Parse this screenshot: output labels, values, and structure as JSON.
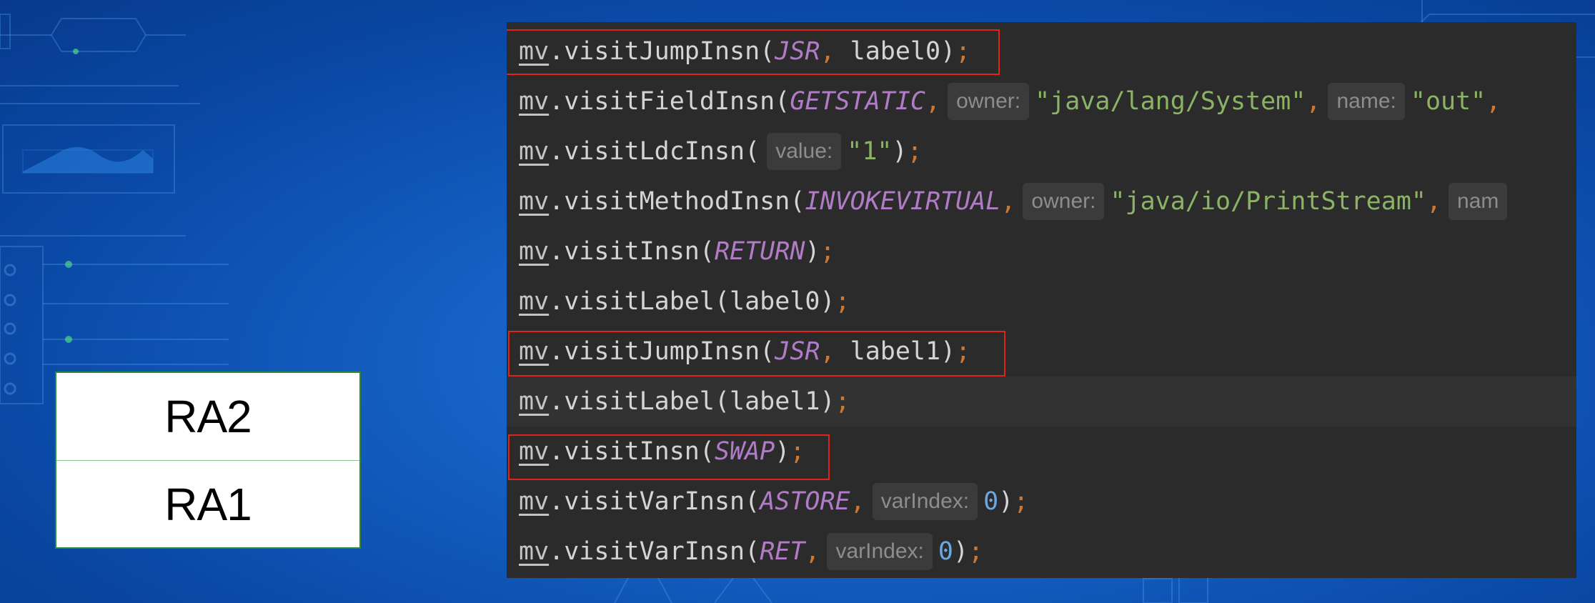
{
  "stack": {
    "top": "RA2",
    "bottom": "RA1"
  },
  "code": {
    "lines": [
      {
        "mv": "mv",
        "method": "visitJumpInsn",
        "const": "JSR",
        "arg": "label0"
      },
      {
        "mv": "mv",
        "method": "visitFieldInsn",
        "const": "GETSTATIC",
        "hint1": "owner:",
        "str1": "\"java/lang/System\"",
        "hint2": "name:",
        "str2": "\"out\""
      },
      {
        "mv": "mv",
        "method": "visitLdcInsn",
        "hint1": "value:",
        "str1": "\"1\""
      },
      {
        "mv": "mv",
        "method": "visitMethodInsn",
        "const": "INVOKEVIRTUAL",
        "hint1": "owner:",
        "str1": "\"java/io/PrintStream\"",
        "hint2": "nam"
      },
      {
        "mv": "mv",
        "method": "visitInsn",
        "const": "RETURN"
      },
      {
        "mv": "mv",
        "method": "visitLabel",
        "arg": "label0"
      },
      {
        "mv": "mv",
        "method": "visitJumpInsn",
        "const": "JSR",
        "arg": "label1"
      },
      {
        "mv": "mv",
        "method": "visitLabel",
        "arg": "label1"
      },
      {
        "mv": "mv",
        "method": "visitInsn",
        "const": "SWAP"
      },
      {
        "mv": "mv",
        "method": "visitVarInsn",
        "const": "ASTORE",
        "hint1": "varIndex:",
        "num": "0"
      },
      {
        "mv": "mv",
        "method": "visitVarInsn",
        "const": "RET",
        "hint1": "varIndex:",
        "num": "0"
      }
    ]
  },
  "colors": {
    "highlight_border": "#e0241b",
    "editor_bg": "#2b2b2b",
    "keyword_constant": "#b07cc6",
    "string": "#8bb365",
    "number": "#6aa8df",
    "punctuation": "#cc7832"
  }
}
